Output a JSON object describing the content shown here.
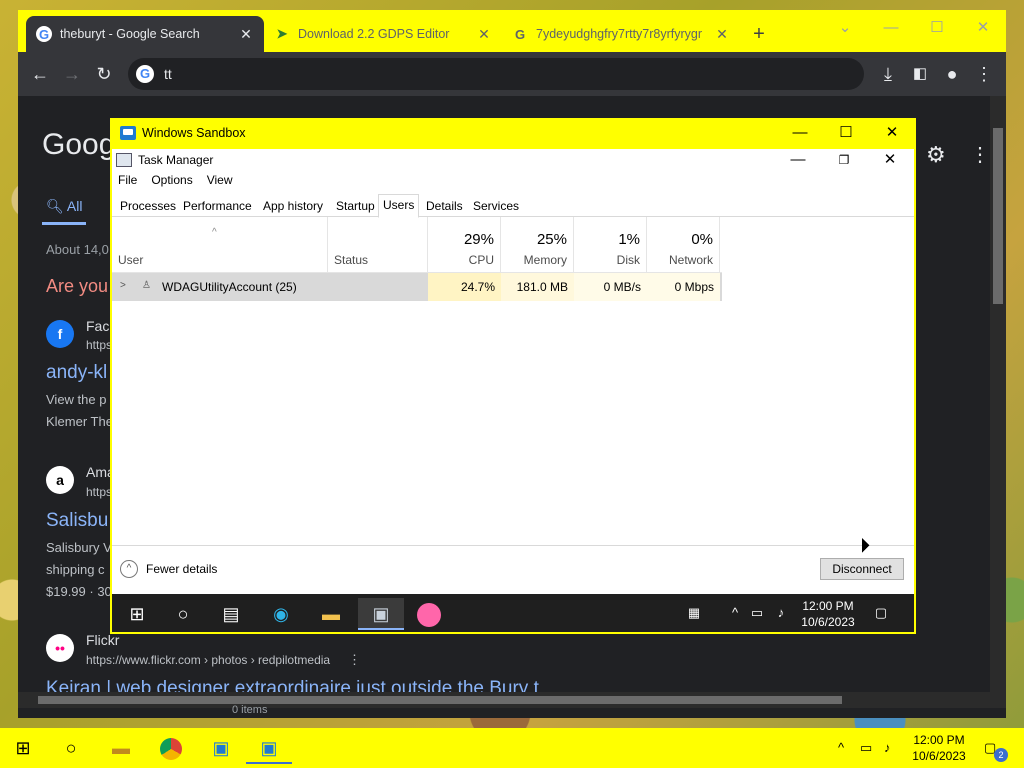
{
  "browser": {
    "tabs": [
      {
        "label": "theburyt - Google Search",
        "icon": "google-icon"
      },
      {
        "label": "Download 2.2 GDPS Editor",
        "icon": "gdps-icon"
      },
      {
        "label": "7ydeyudghgfry7rtty7r8yrfyrygr",
        "icon": "google-icon"
      }
    ],
    "new_tab": "+",
    "address": "tt",
    "page": {
      "logo": "Goog",
      "tab_all": "All",
      "about": "About 14,0",
      "are_you": "Are you",
      "results": [
        {
          "site": "Face",
          "url": "https:",
          "title": "andy-kl",
          "snip1": "View the p",
          "snip2": "Klemer The"
        },
        {
          "site": "Ama",
          "url": "https",
          "title": "Salisbu",
          "snip1": "Salisbury V",
          "snip2": "shipping c",
          "price": "$19.99 · 30"
        },
        {
          "site": "Flickr",
          "url": "https://www.flickr.com › photos › redpilotmedia",
          "title": "Keiran | web designer extraordinaire just outside the Bury t"
        }
      ],
      "status_text": "0 items"
    }
  },
  "sandbox": {
    "title": "Windows Sandbox",
    "task_manager": {
      "title": "Task Manager",
      "menu": [
        "File",
        "Options",
        "View"
      ],
      "tabs": [
        "Processes",
        "Performance",
        "App history",
        "Startup",
        "Users",
        "Details",
        "Services"
      ],
      "selected_tab": "Users",
      "columns": {
        "user": "User",
        "status": "Status",
        "cpu": {
          "pct": "29%",
          "name": "CPU"
        },
        "memory": {
          "pct": "25%",
          "name": "Memory"
        },
        "disk": {
          "pct": "1%",
          "name": "Disk"
        },
        "network": {
          "pct": "0%",
          "name": "Network"
        }
      },
      "rows": [
        {
          "user": "WDAGUtilityAccount (25)",
          "status": "",
          "cpu": "24.7%",
          "memory": "181.0 MB",
          "disk": "0 MB/s",
          "network": "0 Mbps"
        }
      ],
      "fewer_details": "Fewer details",
      "disconnect": "Disconnect"
    },
    "taskbar": {
      "clock_time": "12:00 PM",
      "clock_date": "10/6/2023"
    }
  },
  "taskbar": {
    "clock_time": "12:00 PM",
    "clock_date": "10/6/2023",
    "notification_count": "2"
  }
}
